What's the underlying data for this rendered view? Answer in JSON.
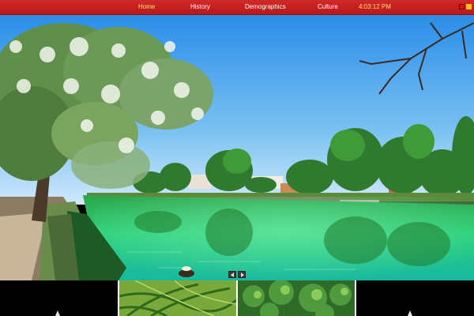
{
  "nav": {
    "items": [
      {
        "label": "Home",
        "active": true
      },
      {
        "label": "History",
        "active": false
      },
      {
        "label": "Demographics",
        "active": false
      },
      {
        "label": "Culture",
        "active": false
      }
    ],
    "clock": "4:03:12 PM"
  },
  "colors": {
    "bar": "#c41d1d",
    "active_nav": "#ffe36a",
    "square_red": "#e01010",
    "square_yellow": "#f2c21a"
  },
  "slideshow": {
    "prev_icon": "arrow-left-icon",
    "next_icon": "arrow-right-icon"
  },
  "thumbnails": [
    {
      "scene": "dark"
    },
    {
      "scene": "palm-leaves"
    },
    {
      "scene": "tree-canopy"
    },
    {
      "scene": "dark"
    }
  ]
}
